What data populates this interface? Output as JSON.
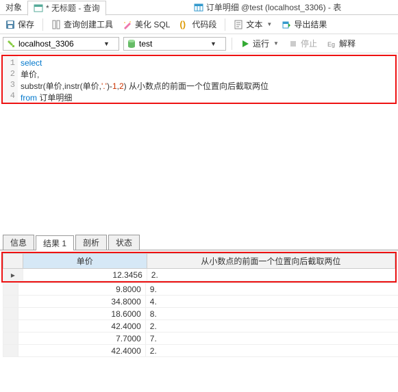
{
  "topTabs": {
    "object": "对象",
    "query": "* 无标题 - 查询",
    "table": "订单明细 @test (localhost_3306) - 表"
  },
  "toolbar": {
    "save": "保存",
    "queryBuilder": "查询创建工具",
    "beautify": "美化 SQL",
    "codeSnippet": "代码段",
    "text": "文本",
    "export": "导出结果"
  },
  "connBar": {
    "connection": "localhost_3306",
    "schema": "test",
    "run": "运行",
    "stop": "停止",
    "explain": "解释"
  },
  "code": {
    "l1a": "select",
    "l2": "单价,",
    "l3a": "substr(单价,instr(单价,",
    "l3s": "'.'",
    "l3b": ")-",
    "l3n1": "1",
    "l3c": ",",
    "l3n2": "2",
    "l3d": ") 从小数点的前面一个位置向后截取两位",
    "l4a": "from",
    "l4b": " 订单明细"
  },
  "bottomTabs": {
    "info": "信息",
    "result": "结果 1",
    "profile": "剖析",
    "status": "状态"
  },
  "grid": {
    "col1": "单价",
    "col2": "从小数点的前面一个位置向后截取两位",
    "rows": [
      {
        "a": "12.3456",
        "b": "2."
      },
      {
        "a": "9.8000",
        "b": "9."
      },
      {
        "a": "34.8000",
        "b": "4."
      },
      {
        "a": "18.6000",
        "b": "8."
      },
      {
        "a": "42.4000",
        "b": "2."
      },
      {
        "a": "7.7000",
        "b": "7."
      },
      {
        "a": "42.4000",
        "b": "2."
      }
    ]
  }
}
